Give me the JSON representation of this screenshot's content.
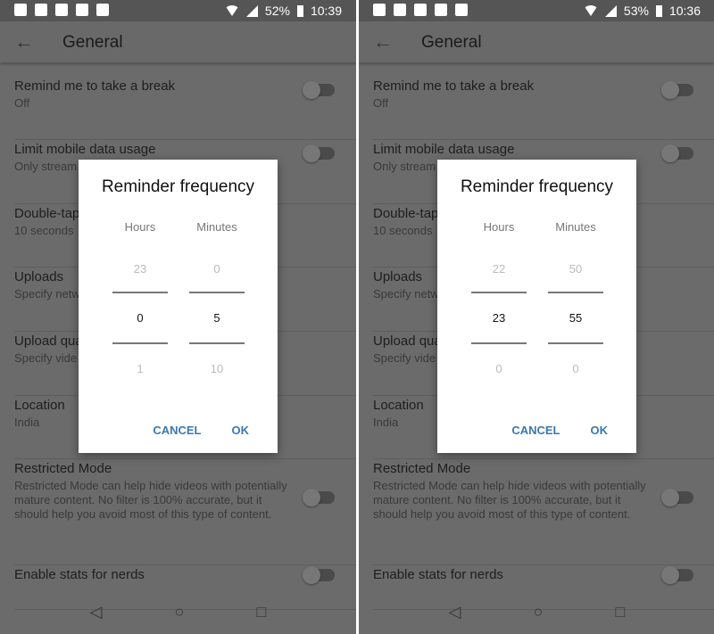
{
  "panels": [
    {
      "status": {
        "battery": "52%",
        "time": "10:39"
      },
      "header": {
        "title": "General"
      },
      "items": [
        {
          "title": "Remind me to take a break",
          "sub": "Off",
          "toggle": false
        },
        {
          "title": "Limit mobile data usage",
          "sub": "Only stream",
          "toggle": false
        },
        {
          "title": "Double-tap",
          "sub": "10 seconds"
        },
        {
          "title": "Uploads",
          "sub": "Specify netw"
        },
        {
          "title": "Upload qua",
          "sub": "Specify vide"
        },
        {
          "title": "Location",
          "sub": "India"
        },
        {
          "title": "Restricted Mode",
          "sub": "Restricted Mode can help hide videos with potentially mature content. No filter is 100% accurate, but it should help you avoid most of this type of content.",
          "toggle": false
        },
        {
          "title": "Enable stats for nerds",
          "sub": "",
          "toggle": false
        }
      ],
      "dialog": {
        "title": "Reminder frequency",
        "hours_label": "Hours",
        "minutes_label": "Minutes",
        "hours": [
          "23",
          "0",
          "1"
        ],
        "minutes": [
          "0",
          "5",
          "10"
        ],
        "cancel": "CANCEL",
        "ok": "OK"
      }
    },
    {
      "status": {
        "battery": "53%",
        "time": "10:36"
      },
      "header": {
        "title": "General"
      },
      "items": [
        {
          "title": "Remind me to take a break",
          "sub": "Off",
          "toggle": false
        },
        {
          "title": "Limit mobile data usage",
          "sub": "Only stream",
          "toggle": false
        },
        {
          "title": "Double-tap",
          "sub": "10 seconds"
        },
        {
          "title": "Uploads",
          "sub": "Specify netw"
        },
        {
          "title": "Upload qua",
          "sub": "Specify vide"
        },
        {
          "title": "Location",
          "sub": "India"
        },
        {
          "title": "Restricted Mode",
          "sub": "Restricted Mode can help hide videos with potentially mature content. No filter is 100% accurate, but it should help you avoid most of this type of content.",
          "toggle": false
        },
        {
          "title": "Enable stats for nerds",
          "sub": "",
          "toggle": false
        }
      ],
      "dialog": {
        "title": "Reminder frequency",
        "hours_label": "Hours",
        "minutes_label": "Minutes",
        "hours": [
          "22",
          "23",
          "0"
        ],
        "minutes": [
          "50",
          "55",
          "0"
        ],
        "cancel": "CANCEL",
        "ok": "OK"
      }
    }
  ],
  "colors": {
    "accent": "#3b78b0",
    "scrim": "#6b6b6b"
  }
}
